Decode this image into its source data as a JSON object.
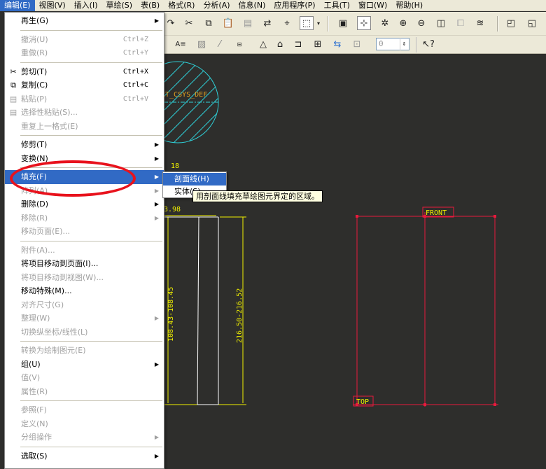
{
  "menubar": {
    "items": [
      {
        "label": "编辑(E)",
        "active": true
      },
      {
        "label": "视图(V)"
      },
      {
        "label": "插入(I)"
      },
      {
        "label": "草绘(S)"
      },
      {
        "label": "表(B)"
      },
      {
        "label": "格式(R)"
      },
      {
        "label": "分析(A)"
      },
      {
        "label": "信息(N)"
      },
      {
        "label": "应用程序(P)"
      },
      {
        "label": "工具(T)"
      },
      {
        "label": "窗口(W)"
      },
      {
        "label": "帮助(H)"
      }
    ]
  },
  "edit_menu": {
    "items": [
      {
        "label": "再生(G)",
        "arrow": true
      },
      {
        "sep": true
      },
      {
        "label": "撤消(U)",
        "shortcut": "Ctrl+Z",
        "disabled": true
      },
      {
        "label": "重做(R)",
        "shortcut": "Ctrl+Y",
        "disabled": true
      },
      {
        "sep": true
      },
      {
        "label": "剪切(T)",
        "shortcut": "Ctrl+X",
        "icon": "cut-icon"
      },
      {
        "label": "复制(C)",
        "shortcut": "Ctrl+C",
        "icon": "copy-icon"
      },
      {
        "label": "粘贴(P)",
        "shortcut": "Ctrl+V",
        "icon": "paste-icon",
        "disabled": true
      },
      {
        "label": "选择性粘贴(S)...",
        "icon": "paste-special-icon",
        "disabled": true
      },
      {
        "label": "重复上一格式(E)",
        "disabled": true
      },
      {
        "sep": true
      },
      {
        "label": "修剪(T)",
        "arrow": true
      },
      {
        "label": "变换(N)",
        "arrow": true
      },
      {
        "sep": true
      },
      {
        "label": "填充(F)",
        "arrow": true,
        "highlighted": true
      },
      {
        "label": "阵列(A)",
        "arrow": true,
        "disabled": true
      },
      {
        "label": "删除(D)",
        "arrow": true
      },
      {
        "label": "移除(R)",
        "arrow": true,
        "disabled": true
      },
      {
        "label": "移动页面(E)...",
        "disabled": true
      },
      {
        "sep": true
      },
      {
        "label": "附件(A)...",
        "disabled": true
      },
      {
        "label": "将项目移动到页面(I)..."
      },
      {
        "label": "将项目移动到视图(W)...",
        "disabled": true
      },
      {
        "label": "移动特殊(M)..."
      },
      {
        "label": "对齐尺寸(G)",
        "disabled": true
      },
      {
        "label": "整理(W)",
        "arrow": true,
        "disabled": true
      },
      {
        "label": "切换纵坐标/线性(L)",
        "disabled": true
      },
      {
        "sep": true
      },
      {
        "label": "转换为绘制图元(E)",
        "disabled": true
      },
      {
        "label": "组(U)",
        "arrow": true
      },
      {
        "label": "值(V)",
        "disabled": true
      },
      {
        "label": "属性(R)",
        "disabled": true
      },
      {
        "sep": true
      },
      {
        "label": "参照(F)",
        "disabled": true
      },
      {
        "label": "定义(N)",
        "disabled": true
      },
      {
        "label": "分组操作",
        "arrow": true,
        "disabled": true
      },
      {
        "sep": true
      },
      {
        "label": "选取(S)",
        "arrow": true
      }
    ]
  },
  "submenu": {
    "items": [
      {
        "label": "剖面线(H)",
        "highlighted": true
      },
      {
        "label": "实体(S)"
      }
    ]
  },
  "tooltip": {
    "text": "用剖面线填充草绘图元界定的区域。"
  },
  "toolbar": {
    "number_field": "0"
  },
  "canvas": {
    "csys_label": "RT_CSYS_DEF",
    "dim_top": "18",
    "dim_width": "3.98",
    "dim_left": "108.43-108.45",
    "dim_right": "216.50-216.52",
    "datum_front": "FRONT",
    "datum_top": "TOP"
  },
  "colors": {
    "menu_highlight": "#316ac5",
    "canvas_bg": "#2e2e2c",
    "datum_red": "#e8193c",
    "dim_yellow": "#f0f000",
    "hatch_cyan": "#2fd0d8",
    "annotation_red": "#e8121c"
  }
}
